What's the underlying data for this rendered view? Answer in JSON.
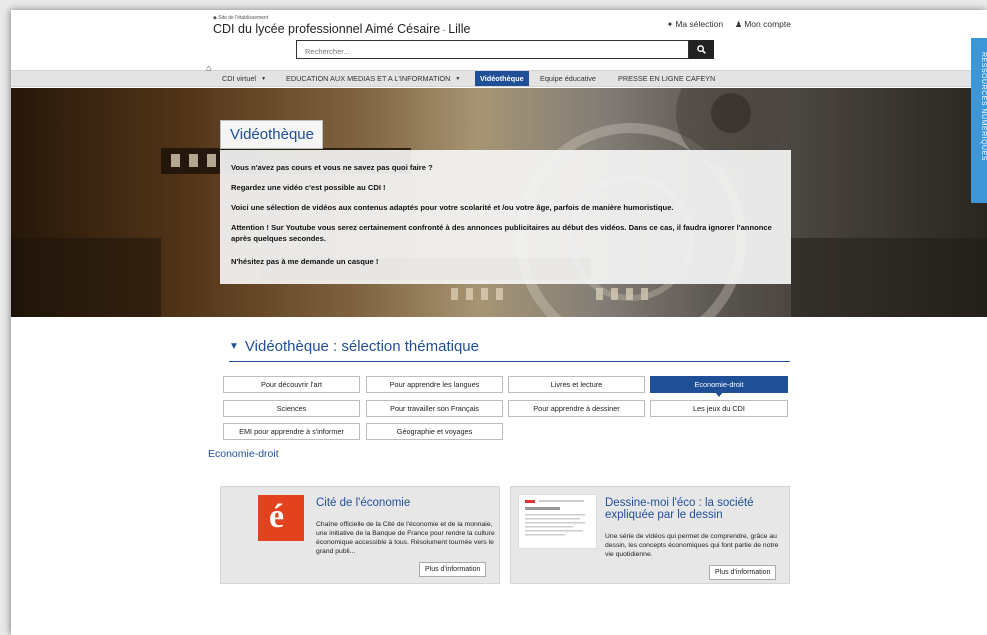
{
  "header": {
    "site_link": "◆ Site de l'établissement",
    "title": "CDI du lycée professionnel Aimé Césaire",
    "title_sep": " - ",
    "title_city": "Lille",
    "my_selection": "Ma sélection",
    "my_account": "Mon compte"
  },
  "search": {
    "placeholder": "Rechercher..."
  },
  "nav": {
    "items": [
      {
        "label": "CDI virtuel"
      },
      {
        "label": "EDUCATION AUX MEDIAS ET A L'INFORMATION"
      },
      {
        "label": "Vidéothèque"
      },
      {
        "label": "Equipe éducative"
      },
      {
        "label": "PRESSE EN LIGNE CAFEYN"
      }
    ]
  },
  "hero": {
    "title": "Vidéothèque",
    "paragraphs": [
      "Vous n'avez pas cours et vous ne savez pas quoi faire ?",
      "Regardez une vidéo c'est possible au CDI !",
      "Voici une sélection de vidéos aux contenus adaptés pour votre scolarité et /ou votre âge, parfois de manière humoristique.",
      "Attention ! Sur Youtube vous serez certainement confronté à des annonces publicitaires au début des vidéos. Dans ce cas, il faudra ignorer l'annonce après quelques secondes.",
      "N'hésitez pas à me demande un casque !"
    ]
  },
  "section": {
    "title": "Vidéothèque : sélection thématique",
    "tags": [
      "Pour découvrir l'art",
      "Pour apprendre les langues",
      "Livres et lecture",
      "Economie-droit",
      "Sciences",
      "Pour travailler son Français",
      "Pour apprendre à dessiner",
      "Les jeux du CDI",
      "EMI pour apprendre à s'informer",
      "Géographie et voyages"
    ],
    "active_tag": "Economie-droit",
    "filter_label": "Economie-droit"
  },
  "cards": [
    {
      "title": "Cité de l'économie",
      "description": "Chaîne officielle de la Cité de l'économie et de la monnaie, une initiative de la Banque de France pour rendre la culture économique accessible à tous. Résolument tournée vers le grand publi...",
      "more": "Plus d'information",
      "logo_letter": "é"
    },
    {
      "title": "Dessine-moi l'éco : la société expliquée par le dessin",
      "description": "Une série de vidéos qui permet de comprendre, grâce au dessin, les concepts économiques qui font partie de notre vie quotidienne.",
      "more": "Plus d'information"
    }
  ],
  "side_tab": {
    "label": "RESSOURCES NUMÉRIQUES"
  },
  "colors": {
    "primary": "#1f4f97",
    "side_tab": "#3d97d6",
    "logo_red": "#e2431e"
  },
  "icons": {
    "search": "search-icon",
    "home": "home-icon",
    "pin": "pin-icon",
    "user": "user-icon"
  }
}
